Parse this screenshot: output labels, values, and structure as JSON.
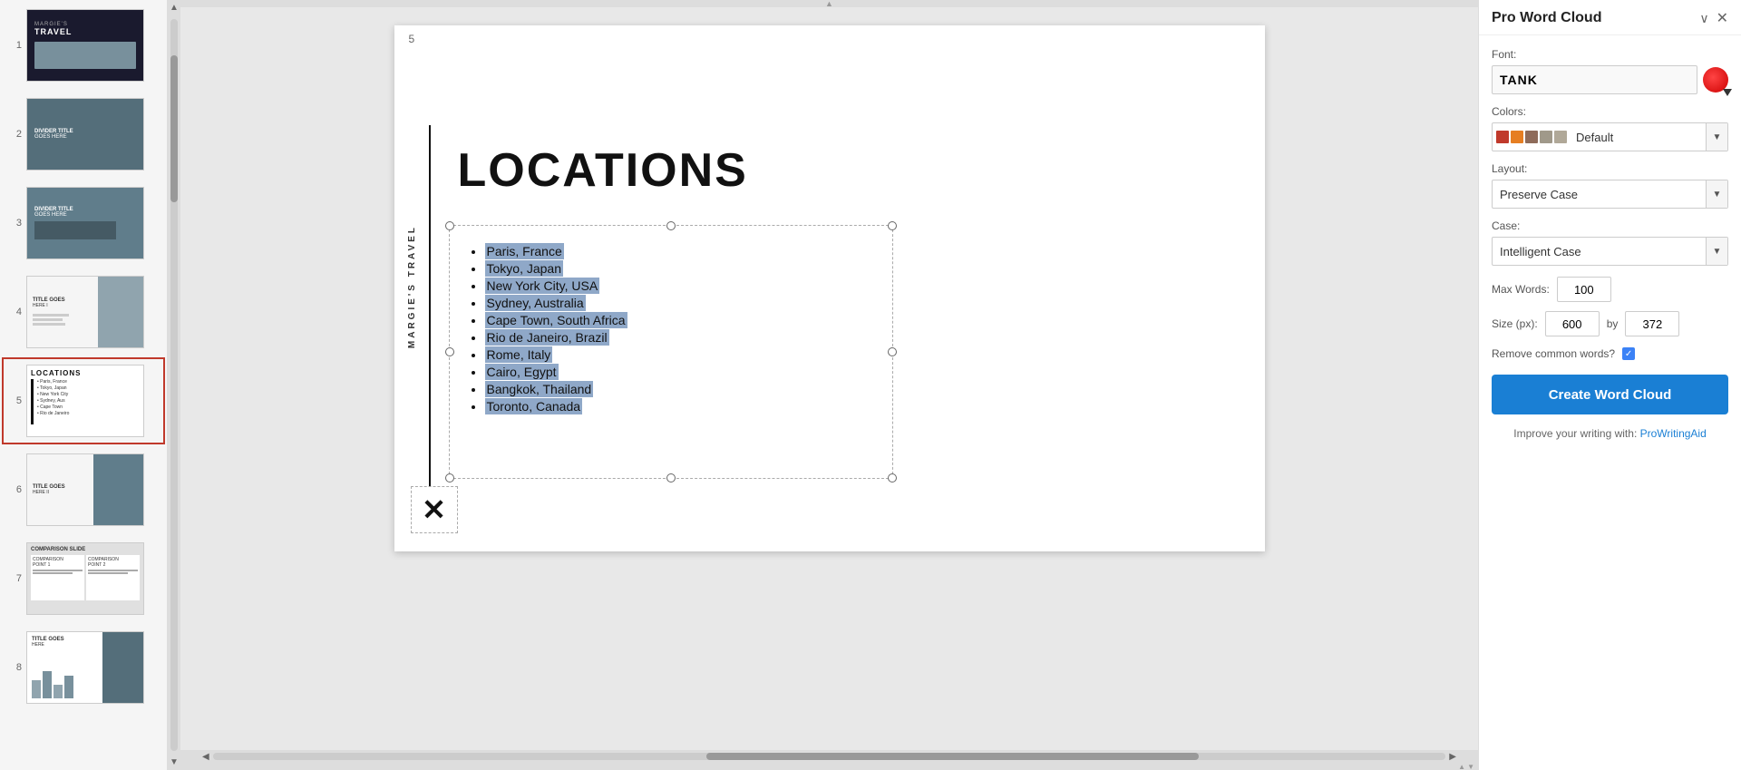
{
  "app": {
    "title": "Pro Word Cloud"
  },
  "thumbnails": [
    {
      "num": "1",
      "label": "MARGIE'S TRAVEL",
      "type": "dark"
    },
    {
      "num": "2",
      "label": "DIVIDER TITLE GOES HERE",
      "type": "medium"
    },
    {
      "num": "3",
      "label": "DIVIDER TITLE GOES HERE",
      "type": "medium-dark"
    },
    {
      "num": "4",
      "label": "TITLE GOES HERE 1",
      "type": "light"
    },
    {
      "num": "5",
      "label": "LOCATIONS",
      "type": "white",
      "active": true
    },
    {
      "num": "6",
      "label": "TITLE GOES HERE II",
      "type": "photo"
    },
    {
      "num": "7",
      "label": "COMPARISON SLIDE",
      "type": "comparison"
    },
    {
      "num": "8",
      "label": "TITLE GOES HERE",
      "type": "chart"
    }
  ],
  "slide": {
    "number": "5",
    "title": "LOCATIONS",
    "vertical_label": "MARGIE'S TRAVEL",
    "locations": [
      "Paris, France",
      "Tokyo, Japan",
      "New York City, USA",
      "Sydney, Australia",
      "Cape Town, South Africa",
      "Rio de Janeiro, Brazil",
      "Rome, Italy",
      "Cairo, Egypt",
      "Bangkok, Thailand",
      "Toronto, Canada"
    ]
  },
  "panel": {
    "title": "Pro Word Cloud",
    "font_label": "Font:",
    "font_value": "TANK",
    "colors_label": "Colors:",
    "colors_default": "Default",
    "layout_label": "Layout:",
    "layout_value": "Preserve Case",
    "case_label": "Case:",
    "case_value": "Intelligent Case",
    "max_words_label": "Max Words:",
    "max_words_value": "100",
    "size_label": "Size (px):",
    "size_width": "600",
    "size_by": "by",
    "size_height": "372",
    "remove_label": "Remove common words?",
    "create_btn": "Create Word Cloud",
    "improve_label": "Improve your writing with:",
    "improve_link": "ProWritingAid",
    "swatches": [
      "#c0392b",
      "#e67e22",
      "#8e6b5a",
      "#a0998a",
      "#b0a898"
    ]
  }
}
